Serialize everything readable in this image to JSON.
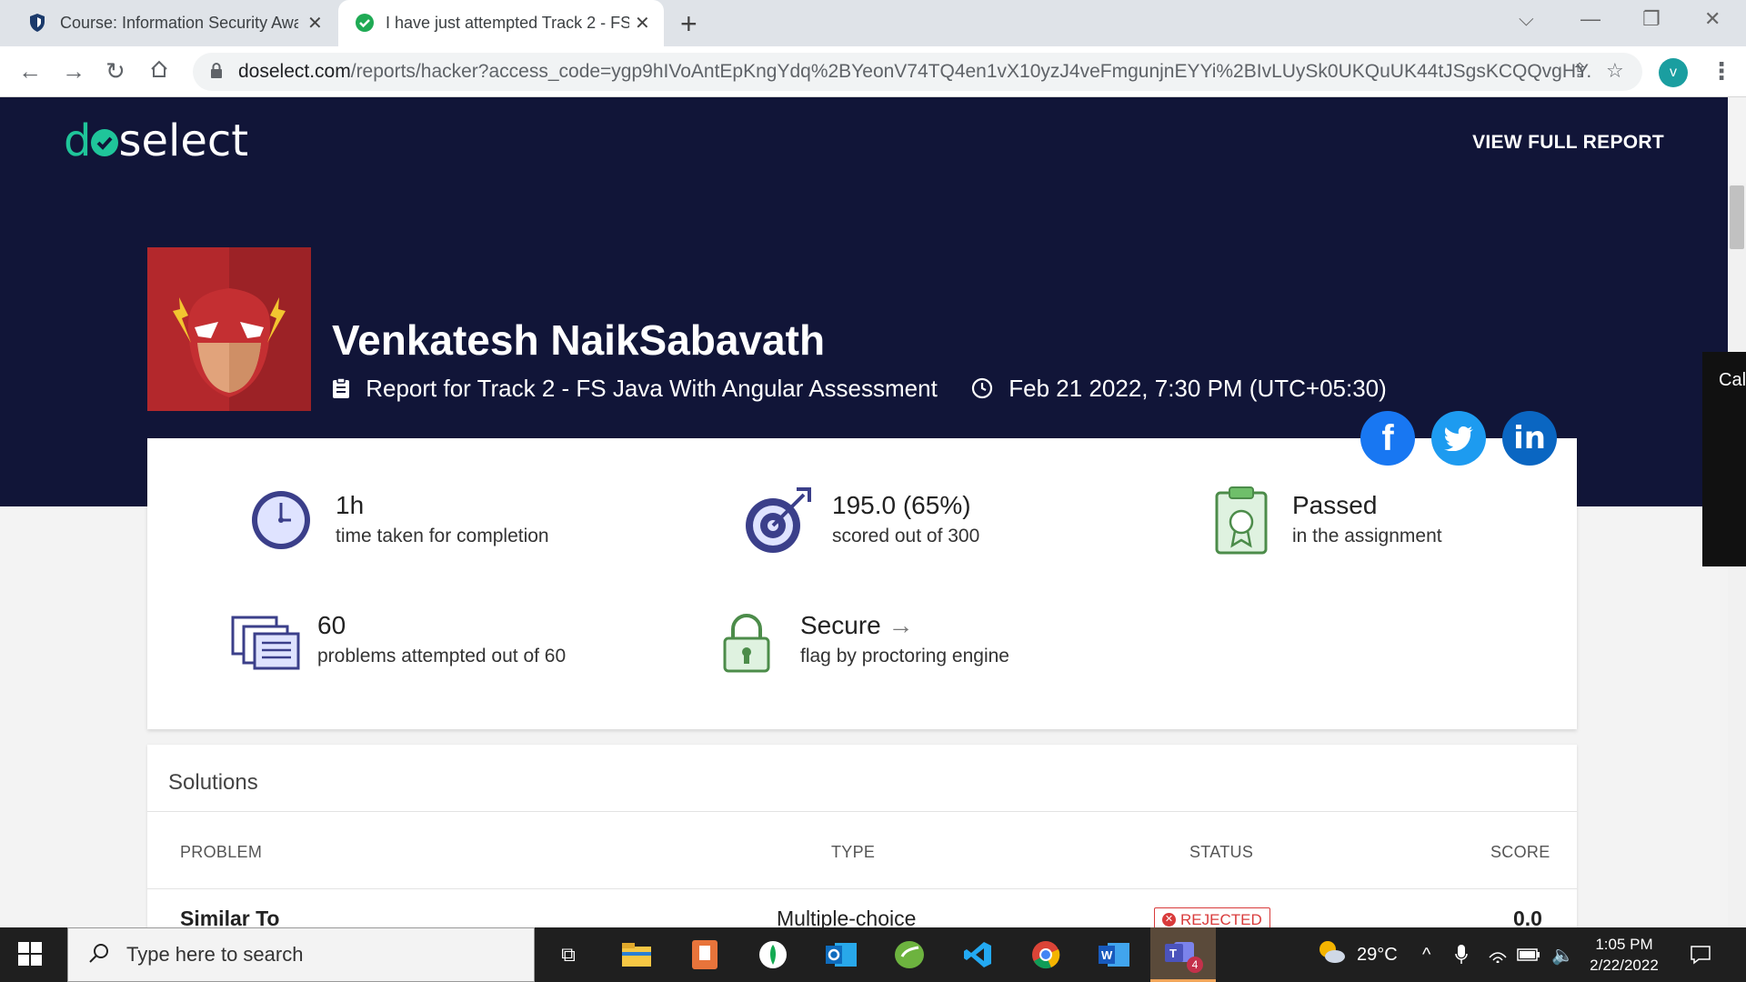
{
  "browser": {
    "tabs": [
      {
        "title": "Course: Information Security Awa",
        "active": false
      },
      {
        "title": "I have just attempted Track 2 - FS",
        "active": true
      }
    ],
    "url_host": "doselect.com",
    "url_rest": "/reports/hacker?access_code=ygp9hIVoAntEpKngYdq%2BYeonV74TQ4en1vX10yzJ4veFmgunjnEYYi%2BIvLUySk0UKQuUK44tJSgsKCQQvgHY...",
    "profile_initial": "v"
  },
  "header": {
    "logo_prefix": "d",
    "logo_suffix": "select",
    "view_full_report": "VIEW FULL REPORT"
  },
  "profile": {
    "name": "Venkatesh NaikSabavath",
    "report_for": "Report for Track 2 - FS Java With Angular Assessment",
    "datetime": "Feb 21 2022, 7:30 PM (UTC+05:30)"
  },
  "social": {
    "facebook": "f",
    "twitter": "twitter-bird",
    "linkedin": "in"
  },
  "stats": {
    "time": {
      "value": "1h",
      "label": "time taken for completion"
    },
    "score": {
      "value": "195.0 (65%)",
      "label": "scored out of 300"
    },
    "result": {
      "value": "Passed",
      "label": "in the assignment"
    },
    "problems": {
      "value": "60",
      "label": "problems attempted out of 60"
    },
    "proctor": {
      "value": "Secure",
      "label": "flag by proctoring engine"
    }
  },
  "solutions": {
    "title": "Solutions",
    "columns": [
      "PROBLEM",
      "TYPE",
      "STATUS",
      "SCORE"
    ],
    "rows": [
      {
        "problem": "Similar To",
        "type": "Multiple-choice",
        "status": "REJECTED",
        "score": "0.0"
      }
    ]
  },
  "side_popup": "Cal",
  "taskbar": {
    "search_placeholder": "Type here to search",
    "weather": "29°C",
    "time": "1:05 PM",
    "date": "2/22/2022",
    "teams_badge": "4"
  },
  "colors": {
    "hero_bg": "#111538",
    "accent_green": "#1fc59a",
    "rejected_red": "#d93b3b",
    "facebook": "#1877f2",
    "twitter": "#1d9bf0",
    "linkedin": "#0a66c2"
  }
}
